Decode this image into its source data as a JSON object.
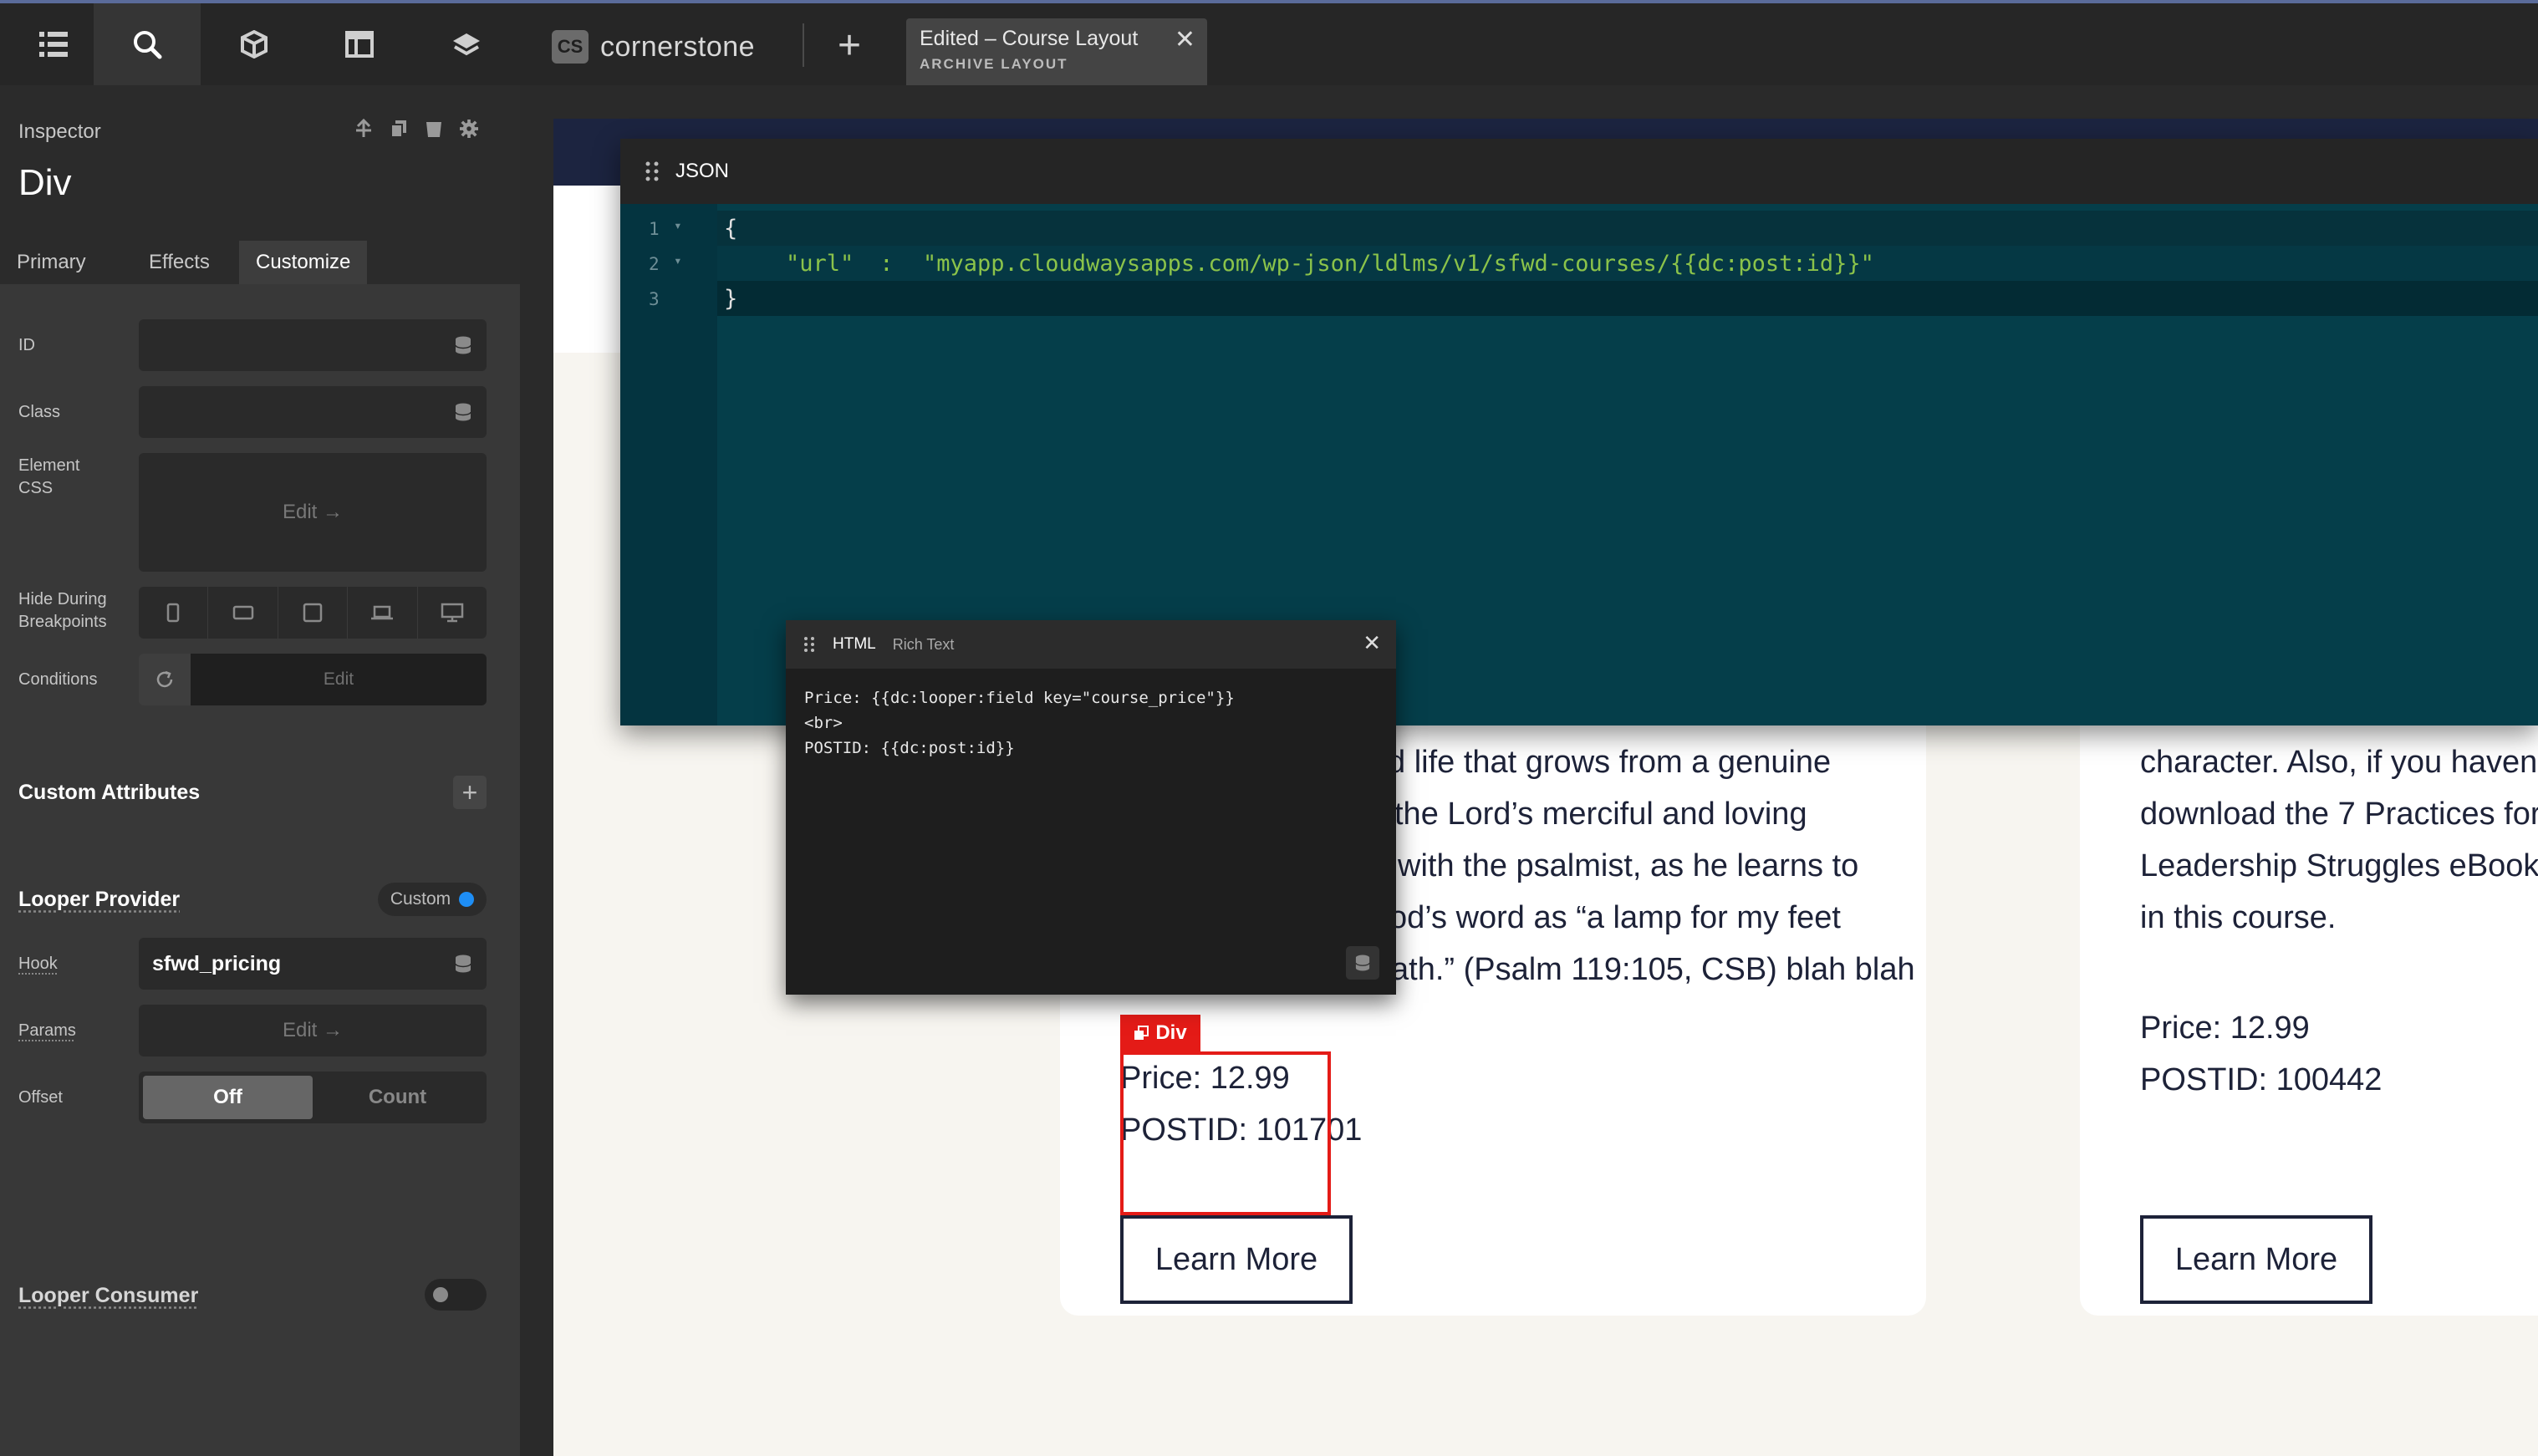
{
  "topbar": {
    "icons": [
      "list-icon",
      "search-icon",
      "cube-icon",
      "layout-icon",
      "layers-icon"
    ],
    "brand_badge": "CS",
    "brand_name": "cornerstone",
    "add_tab_symbol": "+",
    "doc_tab": {
      "title": "Edited – Course Layout",
      "subtitle": "ARCHIVE LAYOUT",
      "close": "✕"
    }
  },
  "inspector": {
    "label": "Inspector",
    "element": "Div",
    "tabs": [
      "Primary",
      "Effects",
      "Customize"
    ],
    "active_tab": "Customize",
    "fields": {
      "id_label": "ID",
      "class_label": "Class",
      "element_css_label": "Element CSS",
      "element_css_button": "Edit →",
      "hide_label": "Hide During Breakpoints",
      "conditions_label": "Conditions",
      "conditions_button": "Edit"
    },
    "custom_attributes": {
      "title": "Custom Attributes",
      "add": "+"
    },
    "looper_provider": {
      "title": "Looper Provider",
      "mode": "Custom",
      "hook_label": "Hook",
      "hook_value": "sfwd_pricing",
      "params_label": "Params",
      "params_button": "Edit →",
      "offset_label": "Offset",
      "offset_options": [
        "Off",
        "Count"
      ],
      "offset_selected": "Off"
    },
    "looper_consumer": {
      "title": "Looper Consumer",
      "enabled": false
    },
    "accent_color": "#1e8ef5"
  },
  "json_editor": {
    "title": "JSON",
    "line_numbers": [
      "1",
      "2",
      "3"
    ],
    "lines": [
      "{",
      "\"url\"",
      " : ",
      "\"myapp.cloudwaysapps.com/wp-json/ldlms/v1/sfwd-courses/{{dc:post:id}}\"",
      "}"
    ],
    "key_color": "#8bc34a",
    "value_color": "#8bc34a"
  },
  "html_editor": {
    "tabs": [
      "HTML",
      "Rich Text"
    ],
    "active_tab": "HTML",
    "close": "✕",
    "code": "Price: {{dc:looper:field key=\"course_price\"}}\n<br>\nPOSTID: {{dc:post:id}}"
  },
  "canvas": {
    "card1": {
      "text_lines": [
        "d life that grows from a genuine",
        "the Lord’s merciful and loving",
        "with the psalmist, as he learns to",
        "od’s word as “a lamp for my feet",
        "ath.” (Psalm 119:105, CSB) blah blah"
      ],
      "price": "Price: 12.99",
      "postid": "POSTID: 101701",
      "button": "Learn More"
    },
    "card2": {
      "text_lines": [
        "character. Also, if you haven't",
        "download the 7 Practices for",
        "Leadership Struggles eBook",
        "in this course."
      ],
      "price": "Price: 12.99",
      "postid": "POSTID: 100442",
      "button": "Learn More"
    },
    "selected_tag": "Div",
    "selection_color": "#e41b17"
  }
}
